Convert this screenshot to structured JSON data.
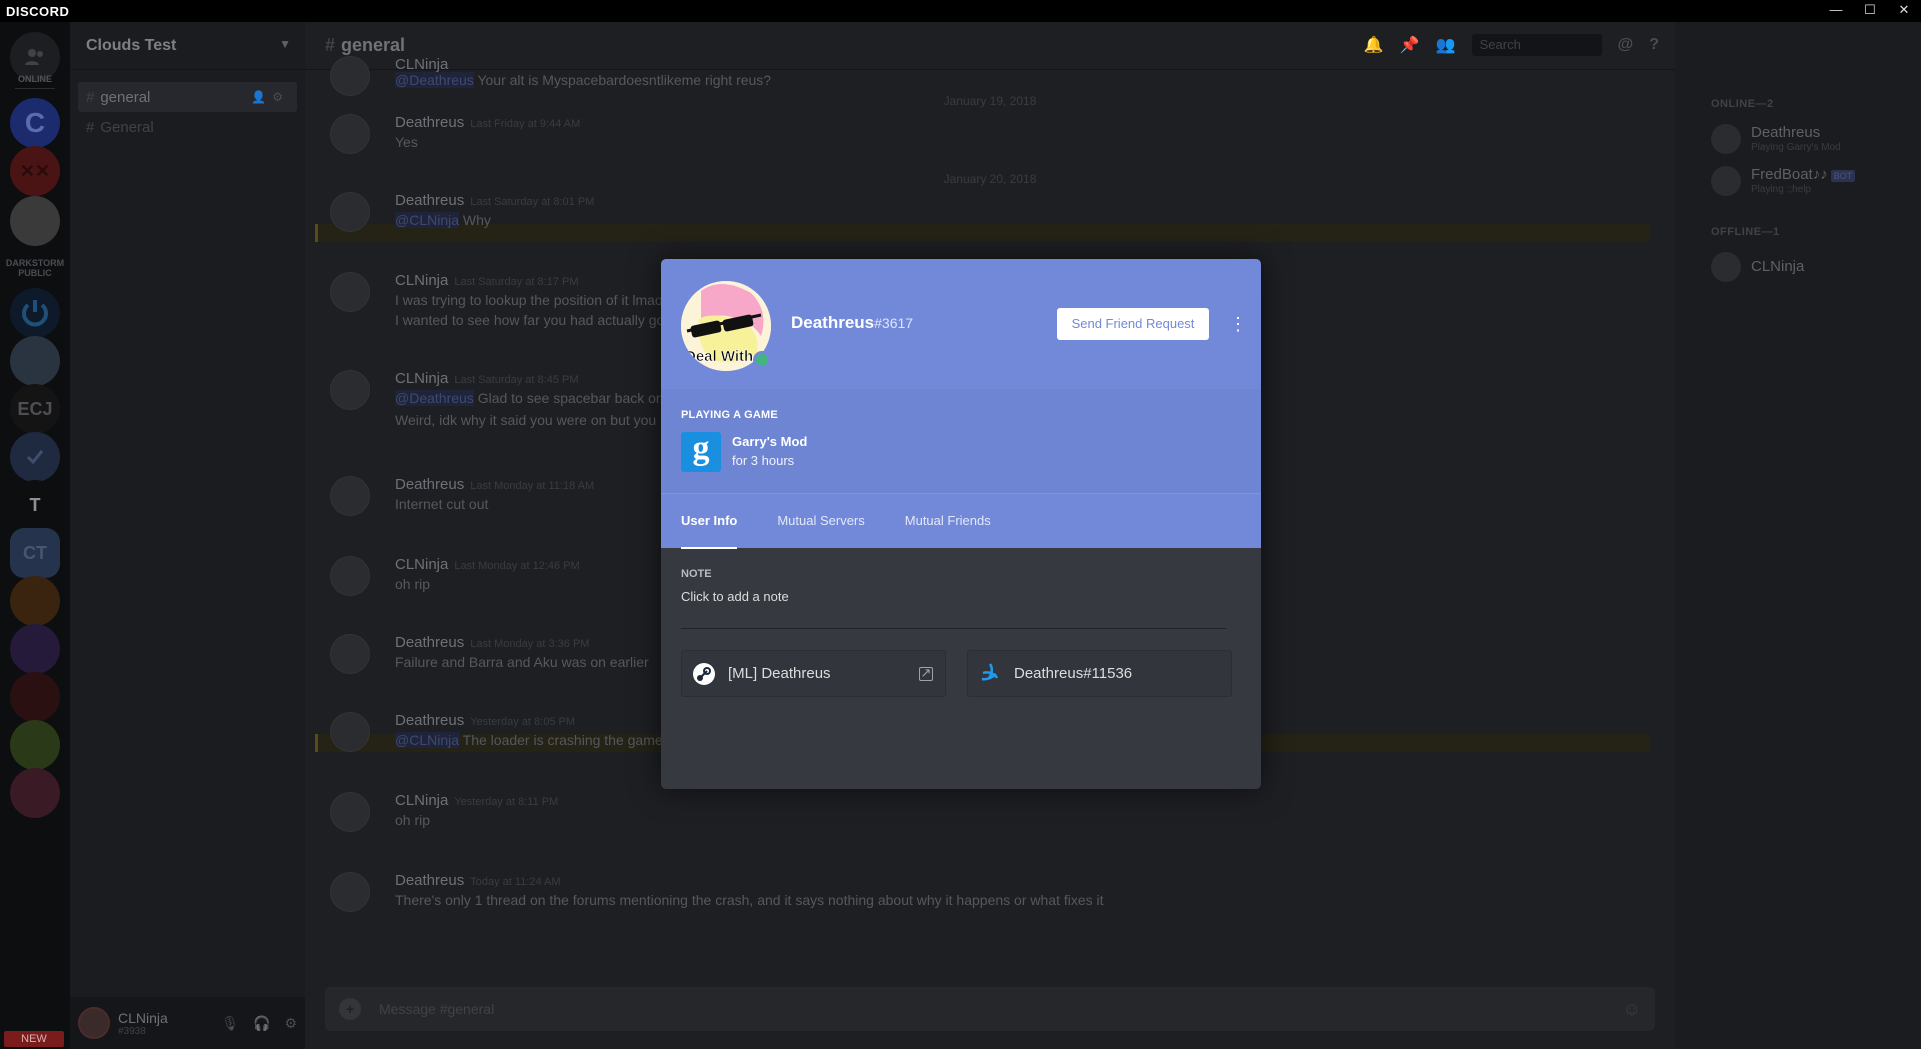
{
  "app": {
    "brand": "DISCORD"
  },
  "window": {
    "minimize": "—",
    "maximize": "☐",
    "close": "✕"
  },
  "servers": {
    "divider_label": "ONLINE",
    "darkstorm_label": "DARKSTORM PUBLIC",
    "ecj_label": "ECJ",
    "t_label": "T",
    "ct_label": "CT",
    "new_badge": "NEW"
  },
  "guild": {
    "name": "Clouds Test"
  },
  "channels": [
    {
      "name": "general"
    },
    {
      "name": "General"
    }
  ],
  "user": {
    "name": "CLNinja",
    "tag": "#3938"
  },
  "chat": {
    "channel": "general",
    "search_placeholder": "Search",
    "composer_placeholder": "Message #general",
    "dates": [
      "January 19, 2018",
      "January 20, 2018"
    ],
    "messages": [
      {
        "author": "CLNinja",
        "mention": "@Deathreus",
        "text": "Your alt is Myspacebardoesntlikeme right reus?"
      },
      {
        "author": "Deathreus",
        "ts": "Last Friday at 9:44 AM",
        "text": "Yes"
      },
      {
        "author": "Deathreus",
        "ts": "Last Saturday at 8:01 PM",
        "mention": "@CLNinja",
        "text": "Why"
      },
      {
        "author": "CLNinja",
        "ts": "Last Saturday at 8:17 PM",
        "text": "I was trying to lookup the position of it lmao and",
        "text2": "I wanted to see how far you had actually gotten"
      },
      {
        "author": "CLNinja",
        "ts": "Last Saturday at 8:45 PM",
        "mention": "@Deathreus",
        "text": "Glad to see spacebar back on tx",
        "text2": "Weird, idk why it said you were on but you aren't"
      },
      {
        "author": "Deathreus",
        "ts": "Last Monday at 11:18 AM",
        "text": "Internet cut out"
      },
      {
        "author": "CLNinja",
        "ts": "Last Monday at 12:46 PM",
        "text": "oh rip"
      },
      {
        "author": "Deathreus",
        "ts": "Last Monday at 3:36 PM",
        "text": "Failure and Barra and Aku was on earlier"
      },
      {
        "author": "Deathreus",
        "ts": "Yesterday at 8:05 PM",
        "mention": "@CLNinja",
        "text": "The loader is crashing the game every time"
      },
      {
        "author": "CLNinja",
        "ts": "Yesterday at 8:11 PM",
        "text": "oh rip"
      },
      {
        "author": "Deathreus",
        "ts": "Today at 11:24 AM",
        "text": "There's only 1 thread on the forums mentioning the crash, and it says nothing about why it happens or what fixes it"
      }
    ]
  },
  "members": {
    "online_header": "ONLINE—2",
    "offline_header": "OFFLINE—1",
    "online": [
      {
        "name": "Deathreus",
        "status": "Playing Garry's Mod"
      },
      {
        "name": "FredBoat♪♪",
        "badge": "BOT",
        "status": "Playing ;;help"
      }
    ],
    "offline": [
      {
        "name": "CLNinja"
      }
    ]
  },
  "profile": {
    "username": "Deathreus",
    "discriminator": "#3617",
    "avatar_caption": "Deal With",
    "friend_button": "Send Friend Request",
    "more": "⋮",
    "activity_header": "PLAYING A GAME",
    "game_icon_letter": "g",
    "game_name": "Garry's Mod",
    "game_time": "for 3 hours",
    "tabs": [
      "User Info",
      "Mutual Servers",
      "Mutual Friends"
    ],
    "note_label": "NOTE",
    "note_placeholder": "Click to add a note",
    "accounts": [
      {
        "service": "steam",
        "name": "[ML] Deathreus"
      },
      {
        "service": "battlenet",
        "name": "Deathreus#11536"
      }
    ],
    "colors": {
      "header": "#7289da",
      "status_online": "#43b581",
      "body": "#36393f"
    }
  }
}
